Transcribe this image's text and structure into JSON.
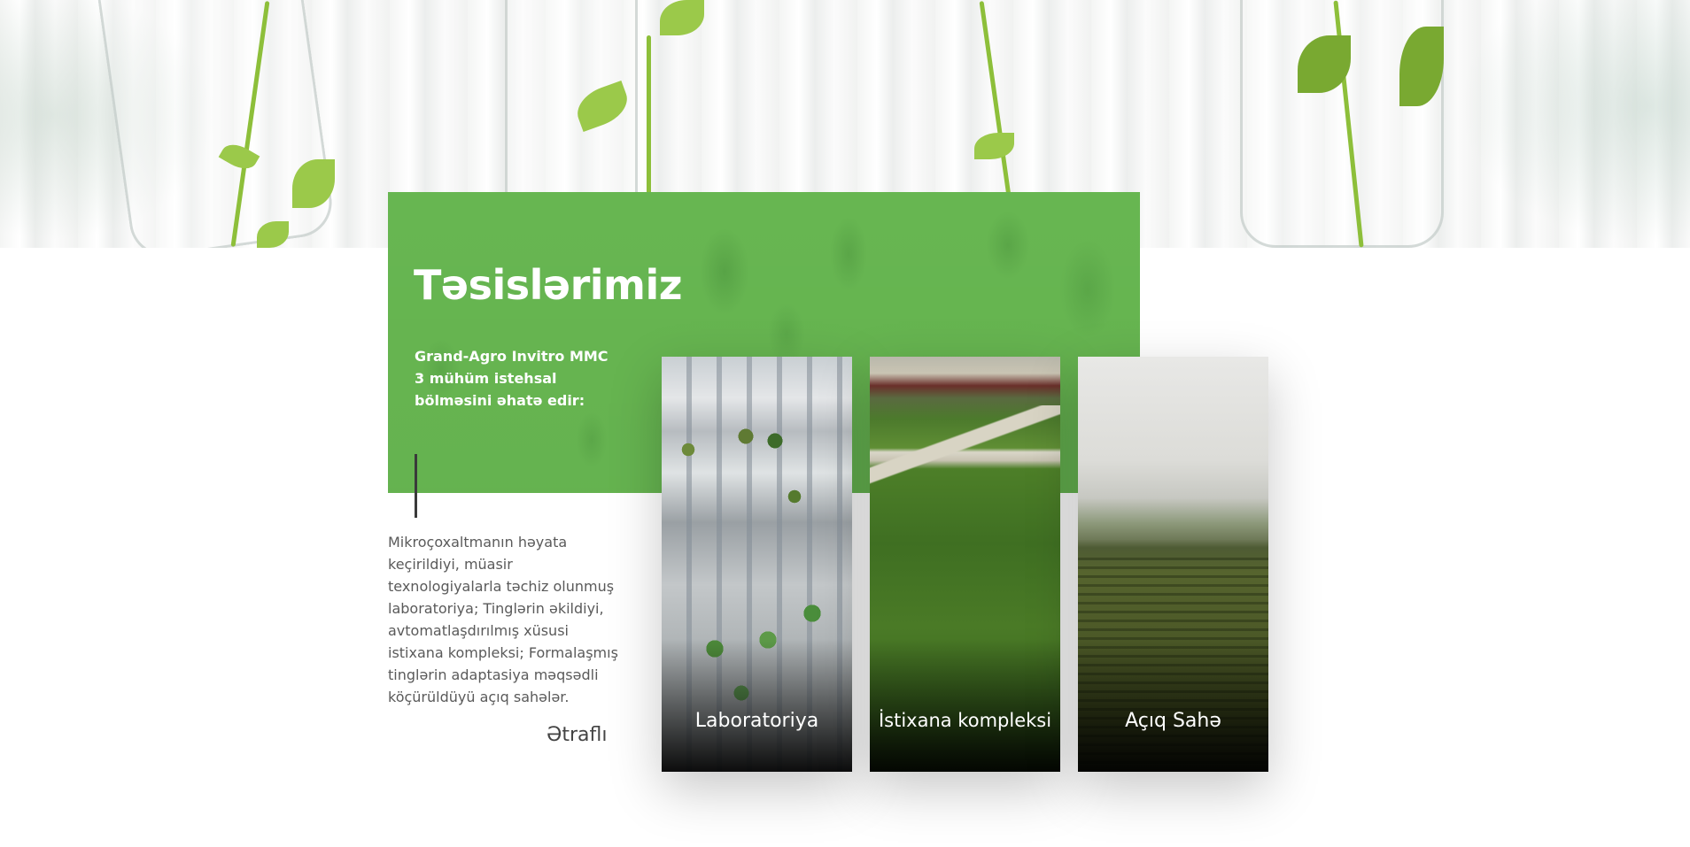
{
  "section": {
    "title": "Təsislərimiz",
    "subtitle": "Grand-Agro Invitro MMC 3 mühüm istehsal bölməsini əhatə edir:",
    "description": "Mikroçoxaltmanın həyata keçirildiyi, müasir texnologiyalarla təchiz olunmuş laboratoriya; Tinglərin əkildiyi, avtomatlaşdırılmış xüsusi istixana kompleksi; Formalaşmış tinglərin adaptasiya məqsədli köçürüldüyü açıq sahələr.",
    "more_link": "Ətraflı"
  },
  "cards": [
    {
      "label": "Laboratoriya"
    },
    {
      "label": "İstixana kompleksi"
    },
    {
      "label": "Açıq Sahə"
    }
  ],
  "colors": {
    "accent_green": "#67b651",
    "text_gray": "#5a5a5a"
  }
}
